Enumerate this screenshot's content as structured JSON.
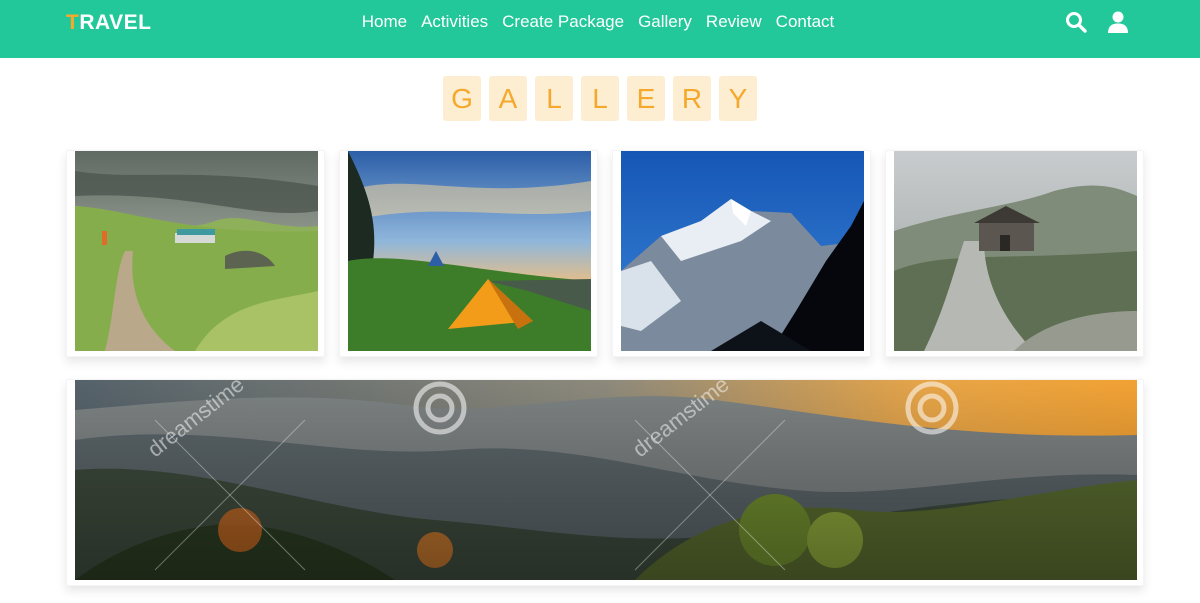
{
  "brand": {
    "first_letter": "T",
    "rest": "RAVEL"
  },
  "nav": {
    "items": [
      {
        "label": "Home"
      },
      {
        "label": "Activities"
      },
      {
        "label": "Create Package"
      },
      {
        "label": "Gallery"
      },
      {
        "label": "Review"
      },
      {
        "label": "Contact"
      }
    ],
    "icons": [
      "search-icon",
      "user-icon"
    ]
  },
  "section": {
    "title_letters": [
      "G",
      "A",
      "L",
      "L",
      "E",
      "R",
      "Y"
    ]
  },
  "gallery": {
    "watermark": "dreamstime"
  },
  "colors": {
    "nav_bg": "#22c89a",
    "accent": "#f5a82c",
    "title_tile_bg": "#fdeed2"
  }
}
